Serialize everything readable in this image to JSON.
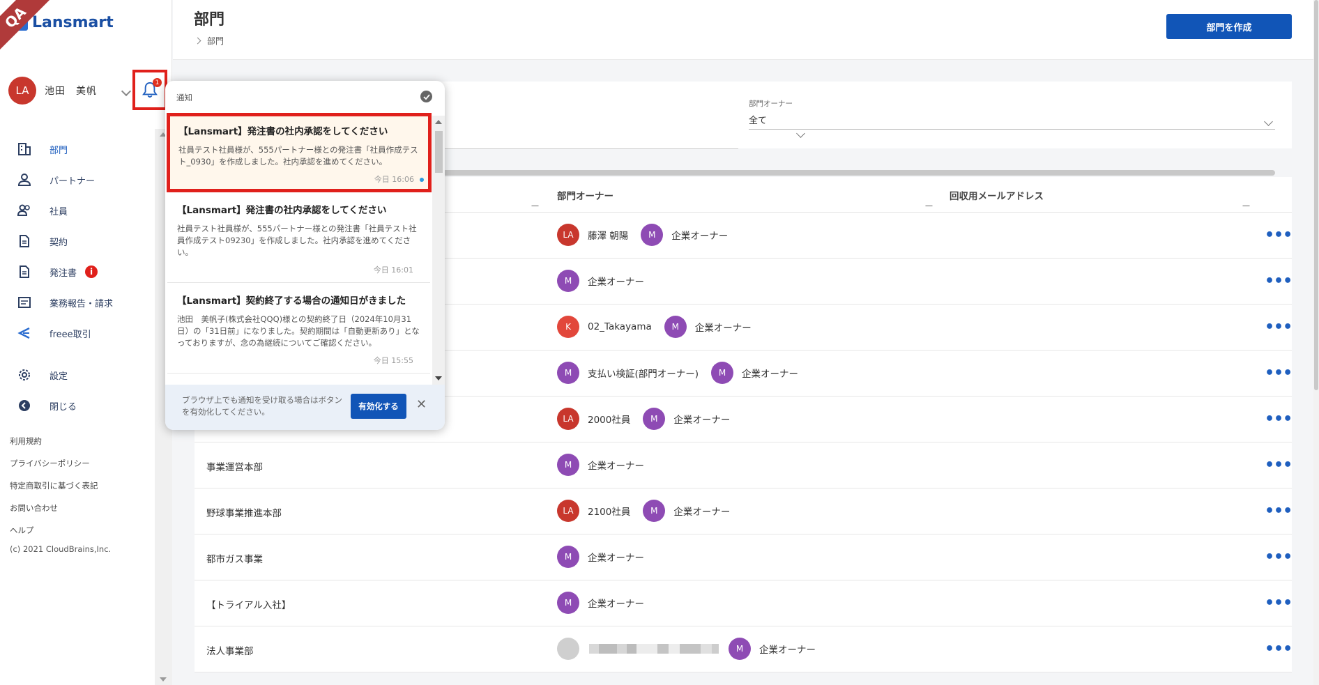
{
  "env_ribbon": "QA",
  "app": {
    "logo_text": "Lansmart"
  },
  "user": {
    "initials": "LA",
    "name": "池田　美帆",
    "notification_count": "1"
  },
  "nav": [
    {
      "key": "dept",
      "label": "部門",
      "icon": "building-icon",
      "active": true
    },
    {
      "key": "partner",
      "label": "パートナー",
      "icon": "person-icon"
    },
    {
      "key": "employee",
      "label": "社員",
      "icon": "people-icon"
    },
    {
      "key": "contract",
      "label": "契約",
      "icon": "document-icon"
    },
    {
      "key": "order",
      "label": "発注書",
      "icon": "document-icon",
      "badge": "i"
    },
    {
      "key": "report",
      "label": "業務報告・請求",
      "icon": "folder-icon"
    },
    {
      "key": "freee",
      "label": "freee取引",
      "icon": "freee-icon"
    },
    {
      "key": "settings",
      "label": "設定",
      "icon": "gear-icon"
    },
    {
      "key": "close",
      "label": "閉じる",
      "icon": "back-circle-icon"
    }
  ],
  "footer_links": [
    "利用規約",
    "プライバシーポリシー",
    "特定商取引に基づく表記",
    "お問い合わせ",
    "ヘルプ"
  ],
  "copyright": "(c) 2021 CloudBrains,Inc.",
  "header": {
    "title": "部門",
    "breadcrumb": "部門",
    "create_button": "部門を作成"
  },
  "filter": {
    "owner_label": "部門オーナー",
    "owner_value": "全て"
  },
  "table": {
    "columns": [
      "部門オーナー",
      "回収用メールアドレス"
    ],
    "rows": [
      {
        "dept": "",
        "owners": [
          {
            "type": "la",
            "initials": "LA",
            "name": "藤澤 朝陽"
          },
          {
            "type": "m",
            "initials": "M",
            "name": "企業オーナー"
          }
        ]
      },
      {
        "dept": "",
        "owners": [
          {
            "type": "m",
            "initials": "M",
            "name": "企業オーナー"
          }
        ]
      },
      {
        "dept": "",
        "owners": [
          {
            "type": "k",
            "initials": "K",
            "name": "02_Takayama"
          },
          {
            "type": "m",
            "initials": "M",
            "name": "企業オーナー"
          }
        ]
      },
      {
        "dept": "",
        "owners": [
          {
            "type": "m",
            "initials": "M",
            "name": "支払い検証(部門オーナー)"
          },
          {
            "type": "m",
            "initials": "M",
            "name": "企業オーナー"
          }
        ]
      },
      {
        "dept": "",
        "owners": [
          {
            "type": "la",
            "initials": "LA",
            "name": "2000社員"
          },
          {
            "type": "m",
            "initials": "M",
            "name": "企業オーナー"
          }
        ]
      },
      {
        "dept": "事業運営本部",
        "owners": [
          {
            "type": "m",
            "initials": "M",
            "name": "企業オーナー"
          }
        ]
      },
      {
        "dept": "野球事業推進本部",
        "owners": [
          {
            "type": "la",
            "initials": "LA",
            "name": "2100社員"
          },
          {
            "type": "m",
            "initials": "M",
            "name": "企業オーナー"
          }
        ]
      },
      {
        "dept": "都市ガス事業",
        "owners": [
          {
            "type": "m",
            "initials": "M",
            "name": "企業オーナー"
          }
        ]
      },
      {
        "dept": "【トライアル入社】",
        "owners": [
          {
            "type": "m",
            "initials": "M",
            "name": "企業オーナー"
          }
        ]
      },
      {
        "dept": "法人事業部",
        "owners": [
          {
            "type": "gray",
            "initials": "",
            "name": "",
            "blurred": true
          },
          {
            "type": "m",
            "initials": "M",
            "name": "企業オーナー"
          }
        ]
      }
    ]
  },
  "notifications": {
    "title": "通知",
    "items": [
      {
        "title": "【Lansmart】発注書の社内承認をしてください",
        "body": "社員テスト社員様が、555パートナー様との発注書「社員作成テスト_0930」を作成しました。社内承認を進めてください。",
        "time": "今日 16:06",
        "unread": true,
        "highlight": true
      },
      {
        "title": "【Lansmart】発注書の社内承認をしてください",
        "body": "社員テスト社員様が、555パートナー様との発注書「社員テスト社員作成テスト09230」を作成しました。社内承認を進めてください。",
        "time": "今日 16:01"
      },
      {
        "title": "【Lansmart】契約終了する場合の通知日がきました",
        "body": "池田　美帆子(株式会社QQQ)様との契約終了日（2024年10月31日）の「31日前」になりました。契約期間は「自動更新あり」となっておりますが、念の為継続についてご確認ください。",
        "time": "今日 15:55"
      }
    ],
    "footer_message": "ブラウザ上でも通知を受け取る場合はボタンを有効化してください。",
    "enable_button": "有効化する"
  }
}
